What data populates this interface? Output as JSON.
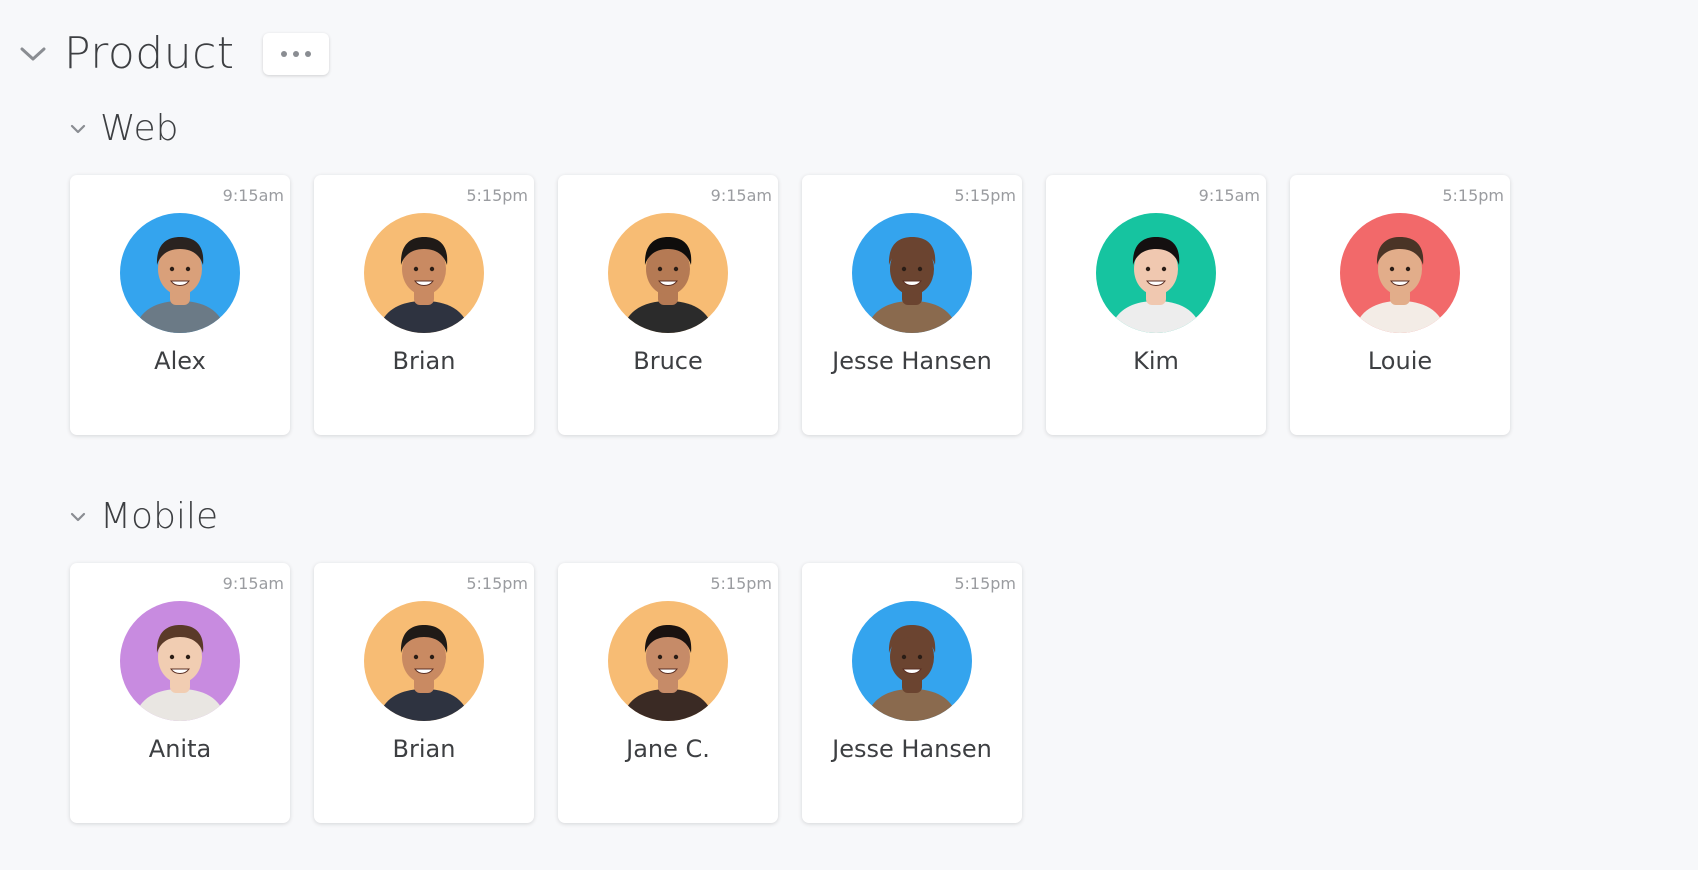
{
  "group": {
    "title": "Product",
    "more_icon": "more-horizontal-icon"
  },
  "sections": [
    {
      "title": "Web",
      "members": [
        {
          "name": "Alex",
          "time": "9:15am",
          "bg": "#34a4ee",
          "skin": "#d9a07a",
          "hair": "#2a2320",
          "shirt": "#6b7a86"
        },
        {
          "name": "Brian",
          "time": "5:15pm",
          "bg": "#f7bc74",
          "skin": "#c98a62",
          "hair": "#1f1a17",
          "shirt": "#2e3340"
        },
        {
          "name": "Bruce",
          "time": "9:15am",
          "bg": "#f7bc74",
          "skin": "#b57a54",
          "hair": "#0f0d0c",
          "shirt": "#2b2b2b"
        },
        {
          "name": "Jesse Hansen",
          "time": "5:15pm",
          "bg": "#34a4ee",
          "skin": "#6b4430",
          "hair": "#6b4430",
          "shirt": "#8a6a4e"
        },
        {
          "name": "Kim",
          "time": "9:15am",
          "bg": "#16c4a0",
          "skin": "#f0c8b0",
          "hair": "#141010",
          "shirt": "#ededed"
        },
        {
          "name": "Louie",
          "time": "5:15pm",
          "bg": "#f2696a",
          "skin": "#e2ad8a",
          "hair": "#4a3426",
          "shirt": "#f3ece6"
        }
      ]
    },
    {
      "title": "Mobile",
      "members": [
        {
          "name": "Anita",
          "time": "9:15am",
          "bg": "#c88be0",
          "skin": "#f1cdb2",
          "hair": "#5a3a28",
          "shirt": "#e9e6e2"
        },
        {
          "name": "Brian",
          "time": "5:15pm",
          "bg": "#f7bc74",
          "skin": "#c98a62",
          "hair": "#1f1a17",
          "shirt": "#2e3340"
        },
        {
          "name": "Jane C.",
          "time": "5:15pm",
          "bg": "#f7bc74",
          "skin": "#c68b68",
          "hair": "#1a1210",
          "shirt": "#3a2a24"
        },
        {
          "name": "Jesse Hansen",
          "time": "5:15pm",
          "bg": "#34a4ee",
          "skin": "#6b4430",
          "hair": "#6b4430",
          "shirt": "#8a6a4e"
        }
      ]
    }
  ]
}
